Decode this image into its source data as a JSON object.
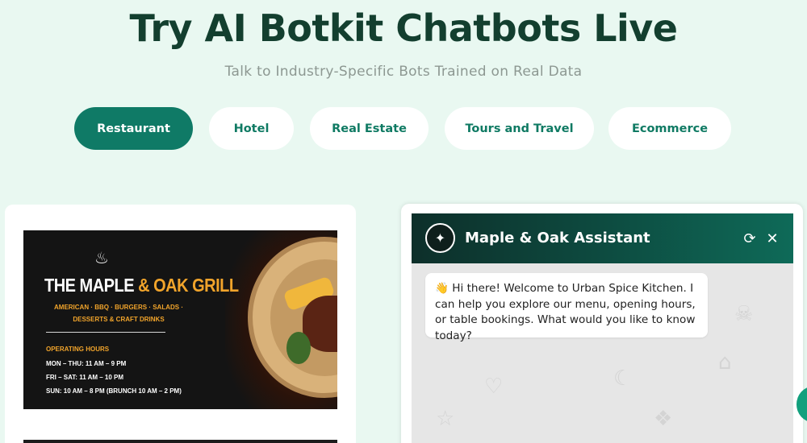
{
  "hero": {
    "title": "Try AI Botkit Chatbots Live",
    "subtitle": "Talk to Industry-Specific Bots Trained on Real Data"
  },
  "tabs": [
    {
      "label": "Restaurant",
      "active": true
    },
    {
      "label": "Hotel",
      "active": false
    },
    {
      "label": "Real Estate",
      "active": false
    },
    {
      "label": "Tours and Travel",
      "active": false
    },
    {
      "label": "Ecommerce",
      "active": false
    }
  ],
  "banner": {
    "title_main": "THE MAPLE ",
    "title_amp": "& ",
    "title_accent": "OAK GRILL",
    "categories": "AMERICAN · BBQ · BURGERS · SALADS · DESSERTS & CRAFT DRINKS",
    "hours_title": "OPERATING HOURS",
    "hours": [
      "MON – THU: 11 AM – 9 PM",
      "FRI – SAT: 11 AM – 10 PM",
      "SUN: 10 AM – 8 PM (BRUNCH 10 AM – 2 PM)"
    ]
  },
  "chat": {
    "bot_name": "Maple & Oak Assistant",
    "avatar_icon": "sparkle-icon",
    "messages": [
      {
        "from": "bot",
        "text": "👋 Hi there! Welcome to Urban Spice Kitchen. I can help you explore our menu, opening hours, or table bookings. What would you like to know today?"
      }
    ]
  },
  "colors": {
    "page_bg": "#e9f8f1",
    "title": "#133f2f",
    "accent": "#0f7a66",
    "banner_accent": "#f1a42b"
  }
}
